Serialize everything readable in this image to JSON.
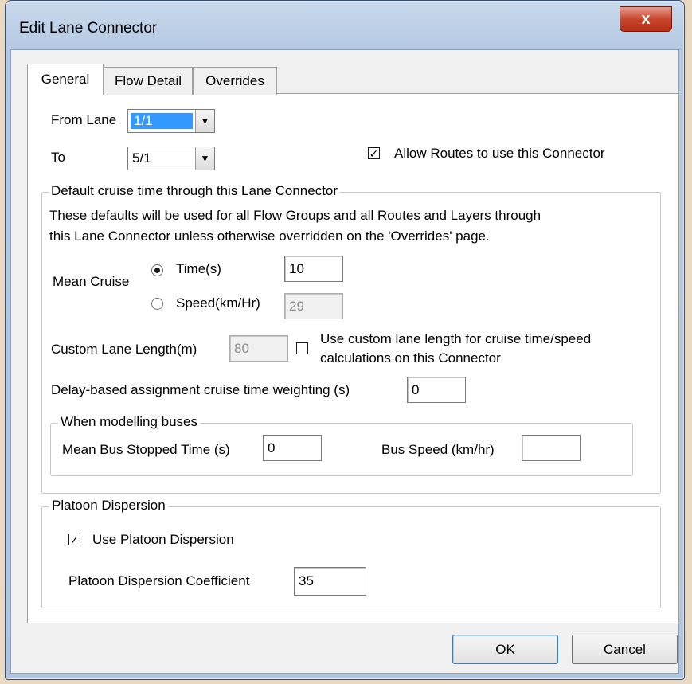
{
  "window": {
    "title": "Edit Lane Connector",
    "close_label": "x"
  },
  "tabs": [
    {
      "label": "General"
    },
    {
      "label": "Flow Detail"
    },
    {
      "label": "Overrides"
    }
  ],
  "general": {
    "from_lane_label": "From Lane",
    "from_lane_value": "1/1",
    "to_label": "To",
    "to_value": "5/1",
    "allow_routes_label": "Allow Routes to use this Connector",
    "allow_routes_checked": true
  },
  "cruise": {
    "group_title": "Default cruise time through this Lane Connector",
    "description_line1": "These defaults will be used for all Flow Groups and all Routes and Layers through",
    "description_line2": "this Lane Connector unless otherwise overridden on the 'Overrides' page.",
    "mean_cruise_label": "Mean Cruise",
    "time_label": "Time(s)",
    "time_value": "10",
    "time_selected": true,
    "speed_label": "Speed(km/Hr)",
    "speed_value": "29",
    "custom_length_label": "Custom Lane Length(m)",
    "custom_length_value": "80",
    "use_custom_line1": "Use custom lane length for cruise time/speed",
    "use_custom_line2": "calculations on this Connector",
    "use_custom_checked": false,
    "delay_label": "Delay-based assignment cruise time weighting (s)",
    "delay_value": "0"
  },
  "buses": {
    "group_title": "When modelling buses",
    "stopped_label": "Mean Bus Stopped Time (s)",
    "stopped_value": "0",
    "speed_label": "Bus Speed (km/hr)",
    "speed_value": ""
  },
  "platoon": {
    "group_title": "Platoon Dispersion",
    "use_label": "Use Platoon Dispersion",
    "use_checked": true,
    "coef_label": "Platoon Dispersion Coefficient",
    "coef_value": "35"
  },
  "footer": {
    "ok_label": "OK",
    "cancel_label": "Cancel"
  }
}
